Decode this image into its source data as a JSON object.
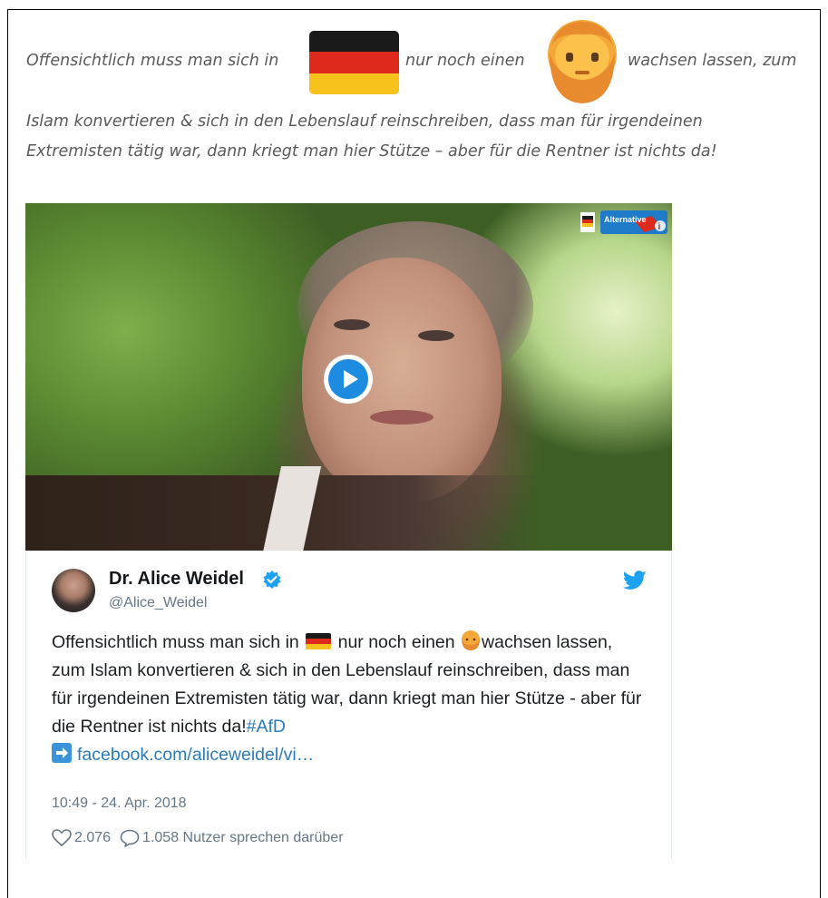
{
  "quote": {
    "line1_a": "Offensichtlich muss man sich in",
    "line1_b": "nur noch einen",
    "line1_c": "wachsen lassen, zum",
    "line2": "Islam konvertieren & sich in den Lebenslauf reinschreiben, dass man für irgendeinen",
    "line3": "Extremisten tätig war, dann kriegt man hier Stütze – aber für die Rentner ist nichts da!"
  },
  "video": {
    "logo_text": "Alternative"
  },
  "tweet": {
    "name": "Dr. Alice Weidel",
    "handle": "@Alice_Weidel",
    "text_a": "Offensichtlich muss man sich in",
    "text_b": "nur noch einen",
    "text_c": "wachsen lassen, zum Islam konvertieren & sich in den Lebenslauf reinschreiben, dass man für irgendeinen Extremisten tätig war, dann kriegt man hier Stütze - aber für die Rentner ist nichts da!",
    "hashtag": "#AfD",
    "link": "facebook.com/aliceweidel/vi…",
    "timestamp": "10:49 - 24. Apr. 2018",
    "likes": "2.076",
    "replies": "1.058 Nutzer sprechen darüber"
  },
  "colors": {
    "accent": "#1d8ce0",
    "link": "#2b7bb9",
    "muted": "#657786",
    "flag_black": "#1a1a1a",
    "flag_red": "#dd2a1c",
    "flag_gold": "#f6c21b"
  },
  "icons": [
    "germany-flag-icon",
    "bearded-face-icon",
    "play-icon",
    "verified-badge-icon",
    "twitter-bird-icon",
    "arrow-right-icon",
    "heart-icon",
    "reply-bubble-icon"
  ]
}
